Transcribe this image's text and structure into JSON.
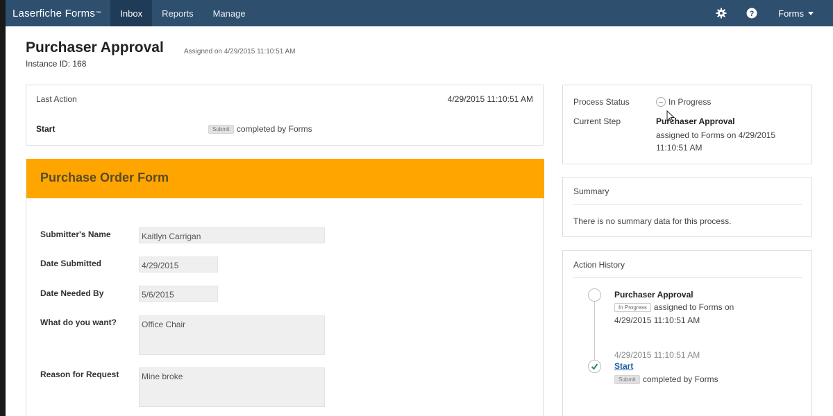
{
  "nav": {
    "brand": "Laserfiche Forms",
    "tm": "™",
    "items": [
      {
        "label": "Inbox",
        "active": true
      },
      {
        "label": "Reports",
        "active": false
      },
      {
        "label": "Manage",
        "active": false
      }
    ],
    "user_menu": "Forms",
    "icons": [
      "gear-icon",
      "help-icon"
    ]
  },
  "header": {
    "title": "Purchaser Approval",
    "assigned": "Assigned on 4/29/2015 11:10:51 AM",
    "instance": "Instance ID: 168"
  },
  "last_action": {
    "title": "Last Action",
    "date": "4/29/2015 11:10:51 AM",
    "step": "Start",
    "badge": "Submit",
    "completed": "completed by Forms"
  },
  "form": {
    "title": "Purchase Order Form",
    "fields": [
      {
        "label": "Submitter's Name",
        "value": "Kaitlyn Carrigan"
      },
      {
        "label": "Date Submitted",
        "value": "4/29/2015"
      },
      {
        "label": "Date Needed By",
        "value": "5/6/2015"
      },
      {
        "label": "What do you want?",
        "value": "Office Chair"
      },
      {
        "label": "Reason for Request",
        "value": "Mine broke"
      }
    ]
  },
  "status": {
    "process_label": "Process Status",
    "process_value": "In Progress",
    "step_label": "Current Step",
    "step_value": "Purchaser Approval",
    "step_detail": "assigned to Forms on 4/29/2015 11:10:51 AM"
  },
  "summary": {
    "title": "Summary",
    "text": "There is no summary data for this process."
  },
  "history": {
    "title": "Action History",
    "entries": [
      {
        "name": "Purchaser Approval",
        "badge": "In Progress",
        "text": "assigned to Forms on",
        "date": "4/29/2015 11:10:51 AM"
      },
      {
        "date": "4/29/2015 11:10:51 AM",
        "name": "Start",
        "badge": "Submit",
        "text": "completed by Forms"
      }
    ]
  },
  "colors": {
    "topbar": "#2f4f6f",
    "active_tab": "#1f3b57",
    "form_header": "#ffa500",
    "link": "#1a5fa8"
  }
}
